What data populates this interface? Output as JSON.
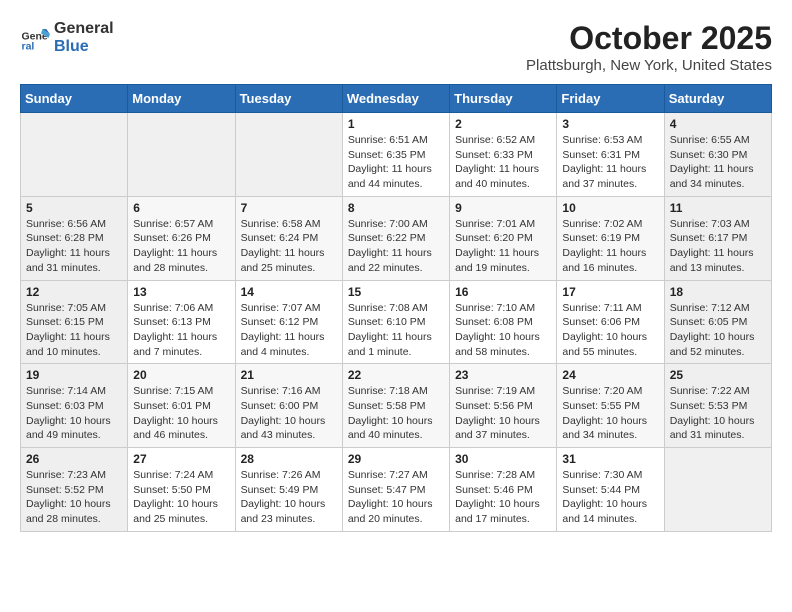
{
  "header": {
    "logo_general": "General",
    "logo_blue": "Blue",
    "month_title": "October 2025",
    "location": "Plattsburgh, New York, United States"
  },
  "days_of_week": [
    "Sunday",
    "Monday",
    "Tuesday",
    "Wednesday",
    "Thursday",
    "Friday",
    "Saturday"
  ],
  "weeks": [
    [
      {
        "day": "",
        "info": ""
      },
      {
        "day": "",
        "info": ""
      },
      {
        "day": "",
        "info": ""
      },
      {
        "day": "1",
        "info": "Sunrise: 6:51 AM\nSunset: 6:35 PM\nDaylight: 11 hours\nand 44 minutes."
      },
      {
        "day": "2",
        "info": "Sunrise: 6:52 AM\nSunset: 6:33 PM\nDaylight: 11 hours\nand 40 minutes."
      },
      {
        "day": "3",
        "info": "Sunrise: 6:53 AM\nSunset: 6:31 PM\nDaylight: 11 hours\nand 37 minutes."
      },
      {
        "day": "4",
        "info": "Sunrise: 6:55 AM\nSunset: 6:30 PM\nDaylight: 11 hours\nand 34 minutes."
      }
    ],
    [
      {
        "day": "5",
        "info": "Sunrise: 6:56 AM\nSunset: 6:28 PM\nDaylight: 11 hours\nand 31 minutes."
      },
      {
        "day": "6",
        "info": "Sunrise: 6:57 AM\nSunset: 6:26 PM\nDaylight: 11 hours\nand 28 minutes."
      },
      {
        "day": "7",
        "info": "Sunrise: 6:58 AM\nSunset: 6:24 PM\nDaylight: 11 hours\nand 25 minutes."
      },
      {
        "day": "8",
        "info": "Sunrise: 7:00 AM\nSunset: 6:22 PM\nDaylight: 11 hours\nand 22 minutes."
      },
      {
        "day": "9",
        "info": "Sunrise: 7:01 AM\nSunset: 6:20 PM\nDaylight: 11 hours\nand 19 minutes."
      },
      {
        "day": "10",
        "info": "Sunrise: 7:02 AM\nSunset: 6:19 PM\nDaylight: 11 hours\nand 16 minutes."
      },
      {
        "day": "11",
        "info": "Sunrise: 7:03 AM\nSunset: 6:17 PM\nDaylight: 11 hours\nand 13 minutes."
      }
    ],
    [
      {
        "day": "12",
        "info": "Sunrise: 7:05 AM\nSunset: 6:15 PM\nDaylight: 11 hours\nand 10 minutes."
      },
      {
        "day": "13",
        "info": "Sunrise: 7:06 AM\nSunset: 6:13 PM\nDaylight: 11 hours\nand 7 minutes."
      },
      {
        "day": "14",
        "info": "Sunrise: 7:07 AM\nSunset: 6:12 PM\nDaylight: 11 hours\nand 4 minutes."
      },
      {
        "day": "15",
        "info": "Sunrise: 7:08 AM\nSunset: 6:10 PM\nDaylight: 11 hours\nand 1 minute."
      },
      {
        "day": "16",
        "info": "Sunrise: 7:10 AM\nSunset: 6:08 PM\nDaylight: 10 hours\nand 58 minutes."
      },
      {
        "day": "17",
        "info": "Sunrise: 7:11 AM\nSunset: 6:06 PM\nDaylight: 10 hours\nand 55 minutes."
      },
      {
        "day": "18",
        "info": "Sunrise: 7:12 AM\nSunset: 6:05 PM\nDaylight: 10 hours\nand 52 minutes."
      }
    ],
    [
      {
        "day": "19",
        "info": "Sunrise: 7:14 AM\nSunset: 6:03 PM\nDaylight: 10 hours\nand 49 minutes."
      },
      {
        "day": "20",
        "info": "Sunrise: 7:15 AM\nSunset: 6:01 PM\nDaylight: 10 hours\nand 46 minutes."
      },
      {
        "day": "21",
        "info": "Sunrise: 7:16 AM\nSunset: 6:00 PM\nDaylight: 10 hours\nand 43 minutes."
      },
      {
        "day": "22",
        "info": "Sunrise: 7:18 AM\nSunset: 5:58 PM\nDaylight: 10 hours\nand 40 minutes."
      },
      {
        "day": "23",
        "info": "Sunrise: 7:19 AM\nSunset: 5:56 PM\nDaylight: 10 hours\nand 37 minutes."
      },
      {
        "day": "24",
        "info": "Sunrise: 7:20 AM\nSunset: 5:55 PM\nDaylight: 10 hours\nand 34 minutes."
      },
      {
        "day": "25",
        "info": "Sunrise: 7:22 AM\nSunset: 5:53 PM\nDaylight: 10 hours\nand 31 minutes."
      }
    ],
    [
      {
        "day": "26",
        "info": "Sunrise: 7:23 AM\nSunset: 5:52 PM\nDaylight: 10 hours\nand 28 minutes."
      },
      {
        "day": "27",
        "info": "Sunrise: 7:24 AM\nSunset: 5:50 PM\nDaylight: 10 hours\nand 25 minutes."
      },
      {
        "day": "28",
        "info": "Sunrise: 7:26 AM\nSunset: 5:49 PM\nDaylight: 10 hours\nand 23 minutes."
      },
      {
        "day": "29",
        "info": "Sunrise: 7:27 AM\nSunset: 5:47 PM\nDaylight: 10 hours\nand 20 minutes."
      },
      {
        "day": "30",
        "info": "Sunrise: 7:28 AM\nSunset: 5:46 PM\nDaylight: 10 hours\nand 17 minutes."
      },
      {
        "day": "31",
        "info": "Sunrise: 7:30 AM\nSunset: 5:44 PM\nDaylight: 10 hours\nand 14 minutes."
      },
      {
        "day": "",
        "info": ""
      }
    ]
  ]
}
